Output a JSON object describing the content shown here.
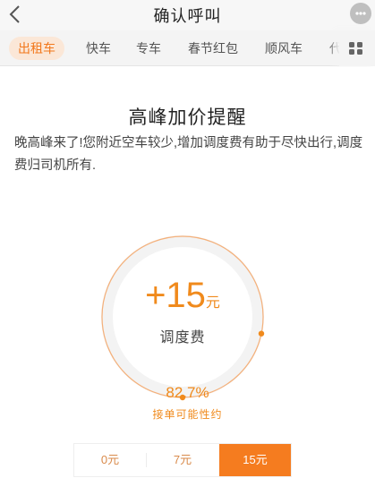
{
  "header": {
    "title": "确认呼叫",
    "back_icon": "chevron-left-icon",
    "message_icon": "chat-bubble-icon"
  },
  "tabs": {
    "items": [
      {
        "label": "出租车",
        "active": true
      },
      {
        "label": "快车",
        "active": false
      },
      {
        "label": "专车",
        "active": false
      },
      {
        "label": "春节红包",
        "active": false
      },
      {
        "label": "顺风车",
        "active": false
      },
      {
        "label": "代",
        "active": false
      }
    ],
    "more_icon": "grid-icon"
  },
  "surge": {
    "heading": "高峰加价提醒",
    "description": "晚高峰来了!您附近空车较少,增加调度费有助于尽快出行,调度费归司机所有.",
    "fee_amount": "+15",
    "fee_unit": "元",
    "fee_label": "调度费",
    "probability": "82.7%",
    "probability_label": "接单可能性约",
    "probability_fraction": 0.827
  },
  "fee_options": [
    {
      "label": "0元",
      "selected": false
    },
    {
      "label": "7元",
      "selected": false
    },
    {
      "label": "15元",
      "selected": true
    }
  ],
  "colors": {
    "accent": "#f57c1f",
    "accent_text": "#f08a1c",
    "tab_active_bg": "#fbe7d7"
  }
}
